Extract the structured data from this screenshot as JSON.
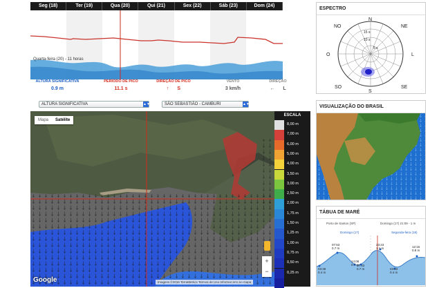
{
  "days": [
    "Seg (18)",
    "Ter (19)",
    "Qua (20)",
    "Qui (21)",
    "Sex (22)",
    "Sáb (23)",
    "Dom (24)"
  ],
  "chart": {
    "tooltip": "Quarta-feira (20) - 11 horas"
  },
  "readings": [
    {
      "label": "ALTURA SIGNIFICATIVA",
      "value": "0.9 m",
      "label_color": "#1d5fc4",
      "value_color": "#1d5fc4"
    },
    {
      "label": "PERÍODO DE PICO",
      "value": "11.1 s",
      "label_color": "#d12b1c",
      "value_color": "#d12b1c"
    },
    {
      "label": "DIREÇÃO DE PICO",
      "value": "S",
      "label_color": "#d12b1c",
      "value_color": "#d12b1c",
      "arrow": "up-arrow"
    },
    {
      "label": "VENTO",
      "value": "3 km/h",
      "label_color": "#888888",
      "value_color": "#555555"
    },
    {
      "label": "DIREÇÃO",
      "value": "L",
      "label_color": "#888888",
      "value_color": "#555555",
      "arrow": "left-arrow"
    }
  ],
  "selectors": {
    "variable": "ALTURA SIGNIFICATIVA",
    "location": "SÃO SEBASTIÃO - CAMBURI"
  },
  "map": {
    "tab_map": "Mapa",
    "tab_satellite": "Satélite",
    "zoom_in": "+",
    "zoom_out": "−",
    "google": "Google",
    "attribution": "Imagens ©2016 TerraMetrics   Termos de Uso   Informar erro no mapa"
  },
  "scale": {
    "title": "ESCALA",
    "items": [
      {
        "label": "8,00 m",
        "color": "#e0e0e0"
      },
      {
        "label": "7,00 m",
        "color": "#d4413a"
      },
      {
        "label": "6,00 m",
        "color": "#e86a2a"
      },
      {
        "label": "5,00 m",
        "color": "#f0a332"
      },
      {
        "label": "4,00 m",
        "color": "#f4d23a"
      },
      {
        "label": "3,50 m",
        "color": "#c9d93b"
      },
      {
        "label": "3,00 m",
        "color": "#7cc63f"
      },
      {
        "label": "2,50 m",
        "color": "#3fae4a"
      },
      {
        "label": "2,00 m",
        "color": "#2f9fd8"
      },
      {
        "label": "1,75 m",
        "color": "#2a86d6"
      },
      {
        "label": "1,50 m",
        "color": "#276fd2"
      },
      {
        "label": "1,25 m",
        "color": "#2458cc"
      },
      {
        "label": "1,00 m",
        "color": "#2247c8"
      },
      {
        "label": "0,75 m",
        "color": "#1f3bc2"
      },
      {
        "label": "0,50 m",
        "color": "#1c30b8"
      },
      {
        "label": "0,25 m",
        "color": "#1a28ad"
      },
      {
        "label": "",
        "color": "#181f9f"
      }
    ]
  },
  "spectrum": {
    "title": "ESPECTRO",
    "dirs": [
      "NO",
      "N",
      "NE",
      "O",
      "L",
      "SO",
      "S",
      "SE"
    ],
    "rings": [
      "15 s",
      "10 s",
      "5 s"
    ]
  },
  "brazil": {
    "title": "VISUALIZAÇÃO DO BRASIL"
  },
  "tide": {
    "title": "TÁBUA DE MARÉ",
    "port": "Porto de Santos (SP)",
    "datetime": "Domingo (17) 21:09 - 1 m",
    "day1": "Domingo (17)",
    "day2": "Segunda-feira (18)",
    "labels": [
      {
        "time": "03:38",
        "height": "0.4 m"
      },
      {
        "time": "07:53",
        "height": "0.7 m"
      },
      {
        "time": "14:08",
        "height": "0.7 m"
      },
      {
        "time": "17:43",
        "height": "0.7 m"
      },
      {
        "time": "23:23",
        "height": "1.1 m"
      },
      {
        "time": "03:43",
        "height": "0.4 m"
      },
      {
        "time": "12:15",
        "height": "0.8 m"
      }
    ]
  },
  "colors": {
    "accent_blue": "#1d5fc4",
    "accent_red": "#d12b1c",
    "wave_fill": "#4b9fd9"
  }
}
